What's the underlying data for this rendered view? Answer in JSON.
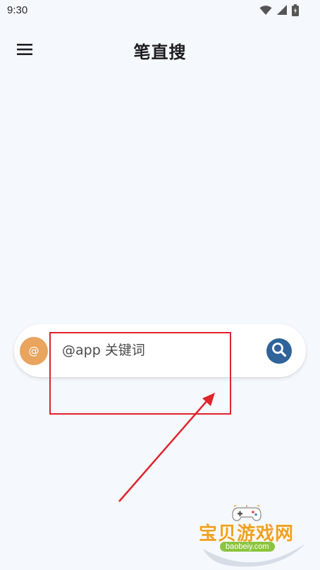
{
  "status_bar": {
    "time": "9:30",
    "icons": [
      "wifi-icon",
      "signal-icon",
      "battery-icon"
    ]
  },
  "app_bar": {
    "menu_icon": "hamburger-menu-icon",
    "title": "笔直搜"
  },
  "search_bar": {
    "at_button_icon": "at-sign-icon",
    "at_button_color": "#e9a45e",
    "input_placeholder": "@app 关键词",
    "input_value": "",
    "search_button_icon": "search-icon",
    "search_button_color": "#2f639a"
  },
  "watermark": {
    "brand": "宝贝游戏网",
    "url": "baobeiy.com"
  },
  "colors": {
    "background": "#f5f9fd",
    "annotation": "#e0242c"
  }
}
